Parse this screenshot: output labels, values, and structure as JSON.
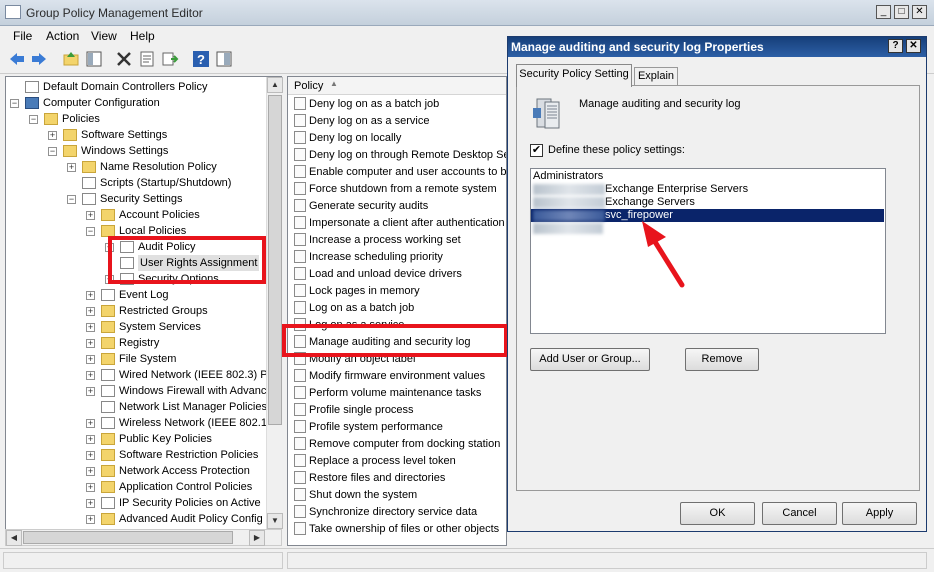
{
  "window": {
    "title": "Group Policy Management Editor"
  },
  "menu": [
    "File",
    "Action",
    "View",
    "Help"
  ],
  "tree": [
    {
      "label": "Default Domain Controllers Policy",
      "depth": 0,
      "exp": "",
      "icon": "doc"
    },
    {
      "label": "Computer Configuration",
      "depth": 0,
      "exp": "−",
      "icon": "pc"
    },
    {
      "label": "Policies",
      "depth": 1,
      "exp": "−",
      "icon": "folder"
    },
    {
      "label": "Software Settings",
      "depth": 2,
      "exp": "+",
      "icon": "folder"
    },
    {
      "label": "Windows Settings",
      "depth": 2,
      "exp": "−",
      "icon": "folder"
    },
    {
      "label": "Name Resolution Policy",
      "depth": 3,
      "exp": "+",
      "icon": "folder"
    },
    {
      "label": "Scripts (Startup/Shutdown)",
      "depth": 3,
      "exp": "",
      "icon": "doc"
    },
    {
      "label": "Security Settings",
      "depth": 3,
      "exp": "−",
      "icon": "doc"
    },
    {
      "label": "Account Policies",
      "depth": 4,
      "exp": "+",
      "icon": "folder"
    },
    {
      "label": "Local Policies",
      "depth": 4,
      "exp": "−",
      "icon": "folder"
    },
    {
      "label": "Audit Policy",
      "depth": 5,
      "exp": "+",
      "icon": "doc"
    },
    {
      "label": "User Rights Assignment",
      "depth": 5,
      "exp": "",
      "icon": "doc",
      "selected": true
    },
    {
      "label": "Security Options",
      "depth": 5,
      "exp": "+",
      "icon": "doc"
    },
    {
      "label": "Event Log",
      "depth": 4,
      "exp": "+",
      "icon": "doc"
    },
    {
      "label": "Restricted Groups",
      "depth": 4,
      "exp": "+",
      "icon": "folder"
    },
    {
      "label": "System Services",
      "depth": 4,
      "exp": "+",
      "icon": "folder"
    },
    {
      "label": "Registry",
      "depth": 4,
      "exp": "+",
      "icon": "folder"
    },
    {
      "label": "File System",
      "depth": 4,
      "exp": "+",
      "icon": "folder"
    },
    {
      "label": "Wired Network (IEEE 802.3) P",
      "depth": 4,
      "exp": "+",
      "icon": "doc"
    },
    {
      "label": "Windows Firewall with Advanc",
      "depth": 4,
      "exp": "+",
      "icon": "doc"
    },
    {
      "label": "Network List Manager Policies",
      "depth": 4,
      "exp": "",
      "icon": "doc"
    },
    {
      "label": "Wireless Network (IEEE 802.1",
      "depth": 4,
      "exp": "+",
      "icon": "doc"
    },
    {
      "label": "Public Key Policies",
      "depth": 4,
      "exp": "+",
      "icon": "folder"
    },
    {
      "label": "Software Restriction Policies",
      "depth": 4,
      "exp": "+",
      "icon": "folder"
    },
    {
      "label": "Network Access Protection",
      "depth": 4,
      "exp": "+",
      "icon": "folder"
    },
    {
      "label": "Application Control Policies",
      "depth": 4,
      "exp": "+",
      "icon": "folder"
    },
    {
      "label": "IP Security Policies on Active",
      "depth": 4,
      "exp": "+",
      "icon": "doc"
    },
    {
      "label": "Advanced Audit Policy Config",
      "depth": 4,
      "exp": "+",
      "icon": "folder"
    }
  ],
  "list": {
    "column": "Policy",
    "items": [
      "Deny log on as a batch job",
      "Deny log on as a service",
      "Deny log on locally",
      "Deny log on through Remote Desktop Se",
      "Enable computer and user accounts to be",
      "Force shutdown from a remote system",
      "Generate security audits",
      "Impersonate a client after authentication",
      "Increase a process working set",
      "Increase scheduling priority",
      "Load and unload device drivers",
      "Lock pages in memory",
      "Log on as a batch job",
      "Log on as a service",
      "Manage auditing and security log",
      "Modify an object label",
      "Modify firmware environment values",
      "Perform volume maintenance tasks",
      "Profile single process",
      "Profile system performance",
      "Remove computer from docking station",
      "Replace a process level token",
      "Restore files and directories",
      "Shut down the system",
      "Synchronize directory service data",
      "Take ownership of files or other objects"
    ]
  },
  "dialog": {
    "title": "Manage auditing and security log Properties",
    "help_label": "?",
    "close_label": "✕",
    "tabs": [
      "Security Policy Setting",
      "Explain"
    ],
    "heading": "Manage auditing and security log",
    "define_label": "Define these policy settings:",
    "define_checked": true,
    "entries": [
      {
        "text": "Administrators",
        "blurred": false,
        "selected": false
      },
      {
        "text": "Exchange Enterprise Servers",
        "blurred": true,
        "selected": false
      },
      {
        "text": "Exchange Servers",
        "blurred": true,
        "selected": false
      },
      {
        "text": "svc_firepower",
        "blurred": true,
        "selected": true
      }
    ],
    "add_label": "Add User or Group...",
    "remove_label": "Remove",
    "ok_label": "OK",
    "cancel_label": "Cancel",
    "apply_label": "Apply"
  },
  "colors": {
    "highlight_box": "#e8141c",
    "selection": "#0a246a",
    "arrow": "#e8141c"
  }
}
